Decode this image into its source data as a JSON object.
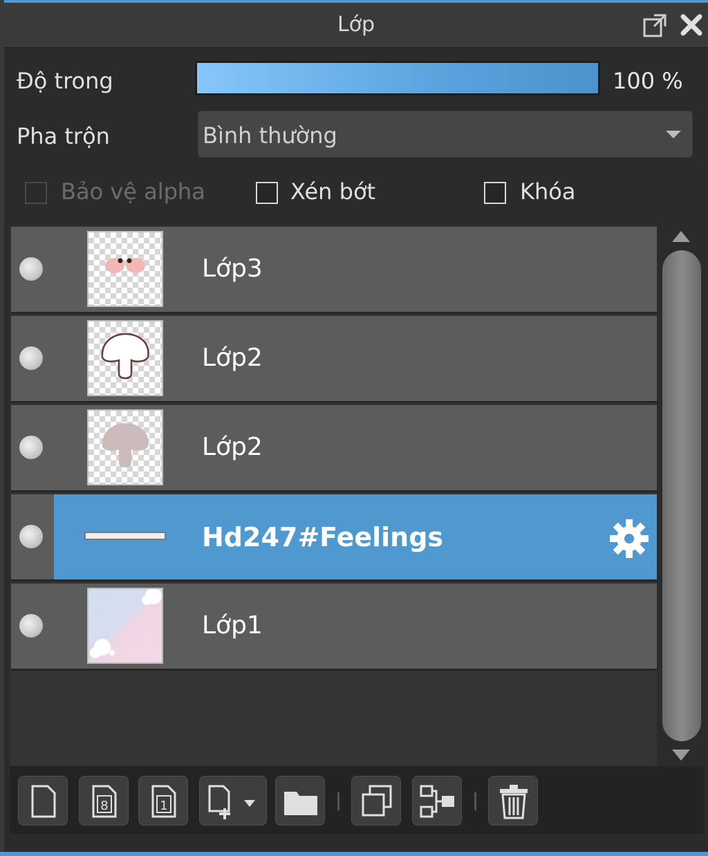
{
  "panel": {
    "title": "Lớp"
  },
  "opacity": {
    "label": "Độ trong",
    "value_text": "100 %",
    "fraction": 1.0
  },
  "blend": {
    "label": "Pha trộn",
    "selected": "Bình thường"
  },
  "options": {
    "protect_alpha": {
      "label": "Bảo vệ alpha",
      "checked": false,
      "enabled": false
    },
    "clip": {
      "label": "Xén bớt",
      "checked": false
    },
    "lock": {
      "label": "Khóa",
      "checked": false
    }
  },
  "layers": [
    {
      "name": "Lớp3",
      "visible": true,
      "selected": false,
      "thumb": "blush-eyes"
    },
    {
      "name": "Lớp2",
      "visible": true,
      "selected": false,
      "thumb": "mushroom-outline"
    },
    {
      "name": "Lớp2",
      "visible": true,
      "selected": false,
      "thumb": "mushroom-fill"
    },
    {
      "name": "Hd247#Feelings",
      "visible": true,
      "selected": true,
      "thumb": "text-layer"
    },
    {
      "name": "Lớp1",
      "visible": true,
      "selected": false,
      "thumb": "pastel-background"
    }
  ],
  "toolbar": {
    "icons": [
      "new-layer-icon",
      "new-8bit-layer-icon",
      "new-1bit-layer-icon",
      "add-layer-menu-icon",
      "folder-icon",
      "duplicate-icon",
      "merge-down-icon",
      "trash-icon"
    ]
  },
  "colors": {
    "accent": "#4d98d6",
    "selected_row": "#4f98d0",
    "row": "#5c5c5c"
  }
}
